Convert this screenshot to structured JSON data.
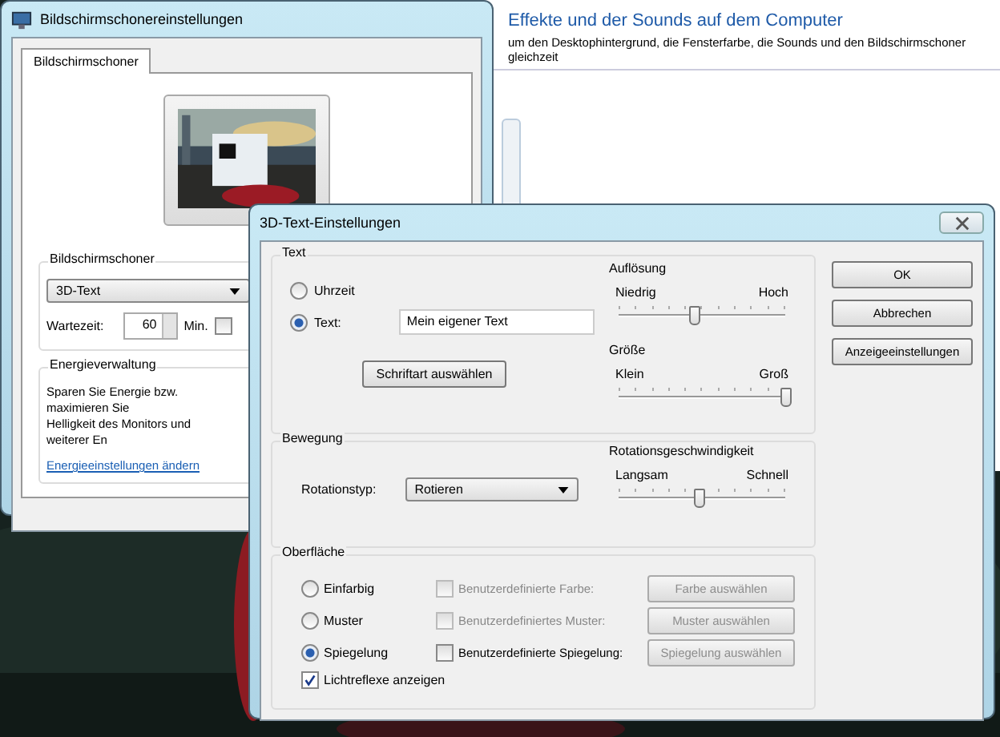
{
  "control_panel": {
    "heading": "Effekte und der Sounds auf dem Computer",
    "description": "um den Desktophintergrund, die Fensterfarbe, die Sounds und den Bildschirmschoner gleichzeit"
  },
  "screensaver_window": {
    "title": "Bildschirmschonereinstellungen",
    "tabs": [
      {
        "label": "Bildschirmschoner",
        "selected": true
      }
    ],
    "screensaver_group": {
      "title": "Bildschirmschoner",
      "dropdown": "3D-Text",
      "wait_label": "Wartezeit:",
      "wait_value": "60",
      "unit": "Min.",
      "resume_checked": false
    },
    "power_group": {
      "title": "Energieverwaltung",
      "lines": [
        "Sparen Sie Energie bzw. maximieren Sie",
        "Helligkeit des Monitors und weiterer En"
      ],
      "link": "Energieeinstellungen ändern"
    }
  },
  "dialog": {
    "title": "3D-Text-Einstellungen",
    "text_group": {
      "title": "Text",
      "options": [
        {
          "label": "Uhrzeit",
          "selected": false
        },
        {
          "label": "Text:",
          "selected": true
        }
      ],
      "text_value": "Mein eigener Text",
      "font_button": "Schriftart auswählen",
      "sliders": [
        {
          "title": "Auflösung",
          "min_label": "Niedrig",
          "max_label": "Hoch",
          "level": 0.45
        },
        {
          "title": "Größe",
          "min_label": "Klein",
          "max_label": "Groß",
          "level": 1
        }
      ]
    },
    "motion_group": {
      "title": "Bewegung",
      "rotation_label": "Rotationstyp:",
      "rotation_value": "Rotieren",
      "slider": {
        "title": "Rotationsgeschwindigkeit",
        "min_label": "Langsam",
        "max_label": "Schnell",
        "level": 0.48
      }
    },
    "surface_group": {
      "title": "Oberfläche",
      "rows": [
        {
          "option": "Einfarbig",
          "selected": false,
          "custom_label": "Benutzerdefinierte Farbe:",
          "custom_checked": false,
          "disabled": true,
          "button": "Farbe auswählen"
        },
        {
          "option": "Muster",
          "selected": false,
          "custom_label": "Benutzerdefiniertes Muster:",
          "custom_checked": false,
          "disabled": true,
          "button": "Muster auswählen"
        },
        {
          "option": "Spiegelung",
          "selected": true,
          "custom_label": "Benutzerdefinierte Spiegelung:",
          "custom_checked": false,
          "disabled": false,
          "button": "Spiegelung auswählen"
        }
      ],
      "reflections_label": "Lichtreflexe anzeigen",
      "reflections_checked": true
    },
    "buttons": [
      "OK",
      "Abbrechen",
      "Anzeigeeinstellungen"
    ]
  }
}
